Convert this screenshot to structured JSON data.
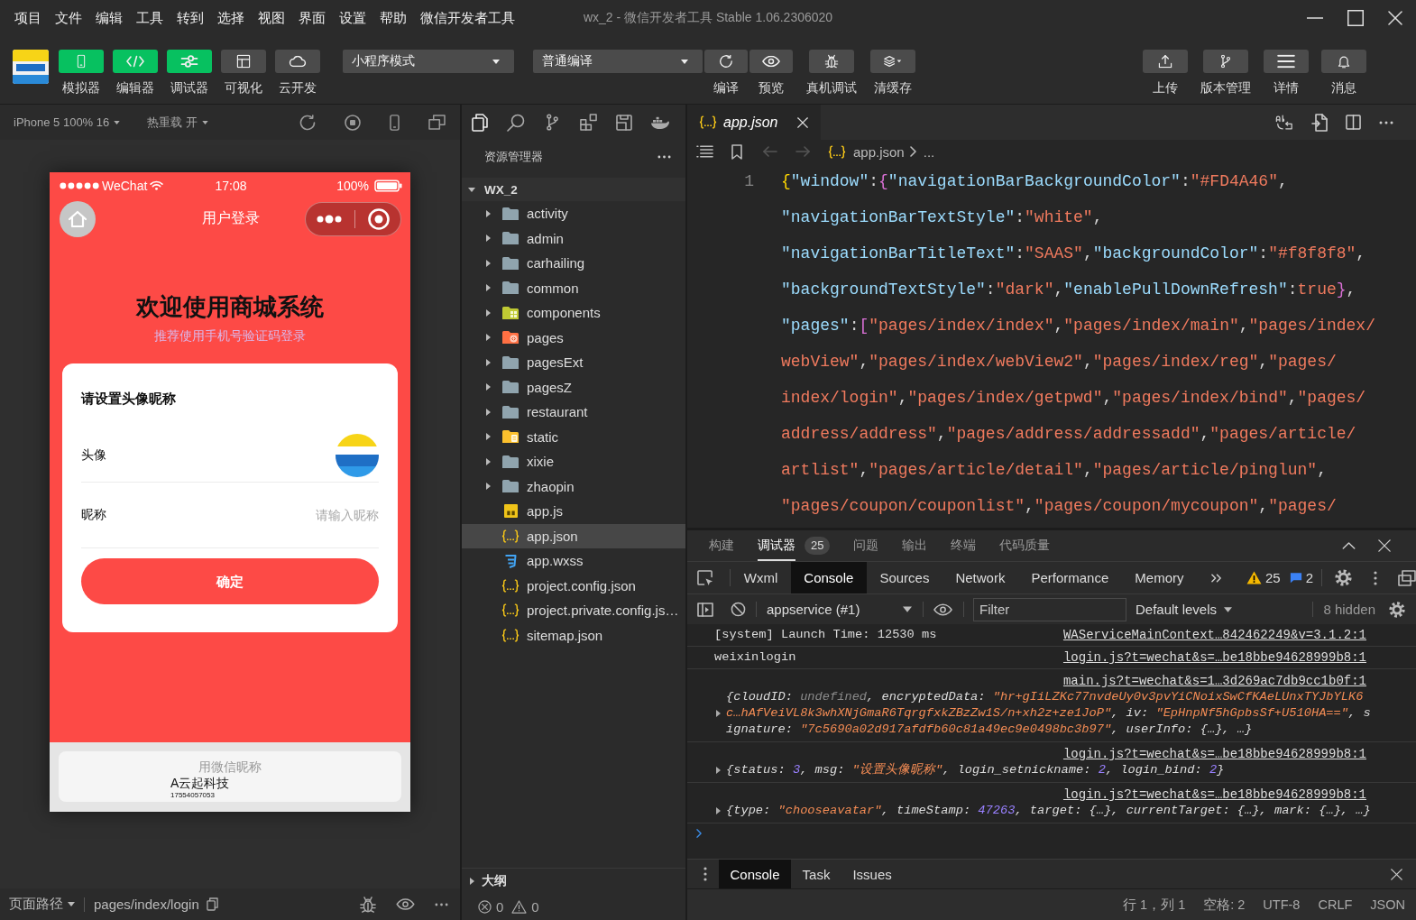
{
  "window": {
    "menu": [
      "项目",
      "文件",
      "编辑",
      "工具",
      "转到",
      "选择",
      "视图",
      "界面",
      "设置",
      "帮助",
      "微信开发者工具"
    ],
    "title": "wx_2 - 微信开发者工具 Stable 1.06.2306020"
  },
  "toolbar": {
    "panels": [
      {
        "kind": "simulator",
        "label": "模拟器",
        "on": true
      },
      {
        "kind": "editor",
        "label": "编辑器",
        "on": true
      },
      {
        "kind": "debugger",
        "label": "调试器",
        "on": true
      },
      {
        "kind": "visual",
        "label": "可视化",
        "on": false
      },
      {
        "kind": "cloud",
        "label": "云开发",
        "on": false
      }
    ],
    "mode": "小程序模式",
    "compile": "普通编译",
    "actions": [
      {
        "kind": "compile",
        "label": "编译"
      },
      {
        "kind": "preview",
        "label": "预览"
      },
      {
        "kind": "debug",
        "label": "真机调试"
      },
      {
        "kind": "cache",
        "label": "清缓存"
      }
    ],
    "tools": [
      {
        "kind": "upload",
        "label": "上传"
      },
      {
        "kind": "version",
        "label": "版本管理"
      },
      {
        "kind": "details",
        "label": "详情"
      },
      {
        "kind": "messages",
        "label": "消息"
      }
    ]
  },
  "simulator": {
    "device": "iPhone 5 100% 16",
    "hot_reload": "热重载 开",
    "phone": {
      "carrier": "WeChat",
      "time": "17:08",
      "battery": "100%",
      "title": "用户登录",
      "heading": "欢迎使用商城系统",
      "subheading": "推荐使用手机号验证码登录",
      "form": {
        "title": "请设置头像昵称",
        "avatar_label": "头像",
        "nickname_label": "昵称",
        "nickname_placeholder": "请输入昵称",
        "submit": "确定"
      },
      "nickname_sheet": {
        "title": "用微信昵称",
        "option": "A云起科技",
        "phone": "17554057053"
      }
    },
    "footer": {
      "path_label": "页面路径",
      "path": "pages/index/login"
    }
  },
  "explorer": {
    "title": "资源管理器",
    "tree": [
      {
        "label": "WX_2",
        "kind": "root",
        "expanded": true,
        "selected": false,
        "children": [
          {
            "label": "activity",
            "kind": "folder",
            "expanded": false,
            "selected": false
          },
          {
            "label": "admin",
            "kind": "folder",
            "expanded": false,
            "selected": false
          },
          {
            "label": "carhailing",
            "kind": "folder",
            "expanded": false,
            "selected": false
          },
          {
            "label": "common",
            "kind": "folder",
            "expanded": false,
            "selected": false
          },
          {
            "label": "components",
            "kind": "componentfolder",
            "expanded": false,
            "selected": false
          },
          {
            "label": "pages",
            "kind": "pagefolder",
            "expanded": false,
            "selected": false
          },
          {
            "label": "pagesExt",
            "kind": "folder",
            "expanded": false,
            "selected": false
          },
          {
            "label": "pagesZ",
            "kind": "folder",
            "expanded": false,
            "selected": false
          },
          {
            "label": "restaurant",
            "kind": "folder",
            "expanded": false,
            "selected": false
          },
          {
            "label": "static",
            "kind": "assetfolder",
            "expanded": false,
            "selected": false
          },
          {
            "label": "xixie",
            "kind": "folder",
            "expanded": false,
            "selected": false
          },
          {
            "label": "zhaopin",
            "kind": "folder",
            "expanded": false,
            "selected": false
          },
          {
            "label": "app.js",
            "kind": "js",
            "selected": false
          },
          {
            "label": "app.json",
            "kind": "json",
            "selected": true
          },
          {
            "label": "app.wxss",
            "kind": "wxss",
            "selected": false
          },
          {
            "label": "project.config.json",
            "kind": "json",
            "selected": false
          },
          {
            "label": "project.private.config.js…",
            "kind": "json",
            "selected": false
          },
          {
            "label": "sitemap.json",
            "kind": "json",
            "selected": false
          }
        ]
      }
    ],
    "outline": "大纲",
    "errors": "0",
    "warnings": "0"
  },
  "editor": {
    "tabs": [
      {
        "label": "app.json",
        "selected": true
      }
    ],
    "breadcrumb": {
      "file": "app.json",
      "trail": "..."
    },
    "line_numbers": [
      "1"
    ],
    "lines": [
      [
        {
          "kind": "brace",
          "text": "{"
        },
        {
          "kind": "key",
          "text": "\"window\""
        },
        {
          "kind": "punct",
          "text": ":"
        },
        {
          "kind": "bracket",
          "text": "{"
        },
        {
          "kind": "key",
          "text": "\"navigationBarBackgroundColor\""
        },
        {
          "kind": "punct",
          "text": ":"
        },
        {
          "kind": "string",
          "text": "\"#FD4A46\""
        },
        {
          "kind": "punct",
          "text": ","
        }
      ],
      [
        {
          "kind": "key",
          "text": "\"navigationBarTextStyle\""
        },
        {
          "kind": "punct",
          "text": ":"
        },
        {
          "kind": "string",
          "text": "\"white\""
        },
        {
          "kind": "punct",
          "text": ","
        }
      ],
      [
        {
          "kind": "key",
          "text": "\"navigationBarTitleText\""
        },
        {
          "kind": "punct",
          "text": ":"
        },
        {
          "kind": "string",
          "text": "\"SAAS\""
        },
        {
          "kind": "punct",
          "text": ","
        },
        {
          "kind": "key",
          "text": "\"backgroundColor\""
        },
        {
          "kind": "punct",
          "text": ":"
        },
        {
          "kind": "string",
          "text": "\"#f8f8f8\""
        },
        {
          "kind": "punct",
          "text": ","
        }
      ],
      [
        {
          "kind": "key",
          "text": "\"backgroundTextStyle\""
        },
        {
          "kind": "punct",
          "text": ":"
        },
        {
          "kind": "string",
          "text": "\"dark\""
        },
        {
          "kind": "punct",
          "text": ","
        },
        {
          "kind": "key",
          "text": "\"enablePullDownRefresh\""
        },
        {
          "kind": "punct",
          "text": ":"
        },
        {
          "kind": "literal",
          "text": "true"
        },
        {
          "kind": "bracket",
          "text": "}"
        },
        {
          "kind": "punct",
          "text": ","
        }
      ],
      [
        {
          "kind": "key",
          "text": "\"pages\""
        },
        {
          "kind": "punct",
          "text": ":"
        },
        {
          "kind": "bracket",
          "text": "["
        },
        {
          "kind": "string",
          "text": "\"pages/index/index\""
        },
        {
          "kind": "punct",
          "text": ","
        },
        {
          "kind": "string",
          "text": "\"pages/index/main\""
        },
        {
          "kind": "punct",
          "text": ","
        },
        {
          "kind": "string",
          "text": "\"pages/index/"
        }
      ],
      [
        {
          "kind": "string",
          "text": "webView\""
        },
        {
          "kind": "punct",
          "text": ","
        },
        {
          "kind": "string",
          "text": "\"pages/index/webView2\""
        },
        {
          "kind": "punct",
          "text": ","
        },
        {
          "kind": "string",
          "text": "\"pages/index/reg\""
        },
        {
          "kind": "punct",
          "text": ","
        },
        {
          "kind": "string",
          "text": "\"pages/"
        }
      ],
      [
        {
          "kind": "string",
          "text": "index/login\""
        },
        {
          "kind": "punct",
          "text": ","
        },
        {
          "kind": "string",
          "text": "\"pages/index/getpwd\""
        },
        {
          "kind": "punct",
          "text": ","
        },
        {
          "kind": "string",
          "text": "\"pages/index/bind\""
        },
        {
          "kind": "punct",
          "text": ","
        },
        {
          "kind": "string",
          "text": "\"pages/"
        }
      ],
      [
        {
          "kind": "string",
          "text": "address/address\""
        },
        {
          "kind": "punct",
          "text": ","
        },
        {
          "kind": "string",
          "text": "\"pages/address/addressadd\""
        },
        {
          "kind": "punct",
          "text": ","
        },
        {
          "kind": "string",
          "text": "\"pages/article/"
        }
      ],
      [
        {
          "kind": "string",
          "text": "artlist\""
        },
        {
          "kind": "punct",
          "text": ","
        },
        {
          "kind": "string",
          "text": "\"pages/article/detail\""
        },
        {
          "kind": "punct",
          "text": ","
        },
        {
          "kind": "string",
          "text": "\"pages/article/pinglun\""
        },
        {
          "kind": "punct",
          "text": ","
        }
      ],
      [
        {
          "kind": "string",
          "text": "\"pages/coupon/couponlist\""
        },
        {
          "kind": "punct",
          "text": ","
        },
        {
          "kind": "string",
          "text": "\"pages/coupon/mycoupon\""
        },
        {
          "kind": "punct",
          "text": ","
        },
        {
          "kind": "string",
          "text": "\"pages/"
        }
      ]
    ]
  },
  "devtools": {
    "panel_tabs": [
      {
        "label": "构建",
        "selected": false
      },
      {
        "label": "调试器",
        "selected": true,
        "badge": "25"
      },
      {
        "label": "问题",
        "selected": false
      },
      {
        "label": "输出",
        "selected": false
      },
      {
        "label": "终端",
        "selected": false
      },
      {
        "label": "代码质量",
        "selected": false
      }
    ],
    "tabs": [
      {
        "label": "Wxml",
        "selected": false
      },
      {
        "label": "Console",
        "selected": true
      },
      {
        "label": "Sources",
        "selected": false
      },
      {
        "label": "Network",
        "selected": false
      },
      {
        "label": "Performance",
        "selected": false
      },
      {
        "label": "Memory",
        "selected": false
      }
    ],
    "warning_count": "25",
    "message_count": "2",
    "context": "appservice (#1)",
    "filter_placeholder": "Filter",
    "levels": "Default levels",
    "hidden": "8 hidden",
    "logs": [
      {
        "kind": "text",
        "source": "WAServiceMainContext…842462249&v=3.1.2:1",
        "lines": [
          [
            {
              "kind": "plain",
              "text": "[system] Launch Time: 12530 ms"
            }
          ]
        ]
      },
      {
        "kind": "text",
        "source": "login.js?t=wechat&s=…be18bbe94628999b8:1",
        "lines": [
          [
            {
              "kind": "plain",
              "text": "weixinlogin"
            }
          ]
        ]
      },
      {
        "kind": "object",
        "source": "main.js?t=wechat&s=1…3d269ac7db9cc1b0f:1",
        "lines": [
          [
            {
              "kind": "punct",
              "text": "{"
            },
            {
              "kind": "key",
              "text": "cloudID"
            },
            {
              "kind": "punct",
              "text": ": "
            },
            {
              "kind": "undefined",
              "text": "undefined"
            },
            {
              "kind": "punct",
              "text": ", "
            },
            {
              "kind": "key",
              "text": "encryptedData"
            },
            {
              "kind": "punct",
              "text": ": "
            },
            {
              "kind": "string",
              "text": "\"hr+gIiLZKc77nvdeUy0v3pvYiCNoixSwCfKAeLUnxTYJbYLK6"
            }
          ],
          [
            {
              "kind": "string",
              "text": "c…hAfVeiVL8k3whXNjGmaR6TqrgfxkZBzZw1S/n+xh2z+ze1JoP\""
            },
            {
              "kind": "punct",
              "text": ", "
            },
            {
              "kind": "key",
              "text": "iv"
            },
            {
              "kind": "punct",
              "text": ": "
            },
            {
              "kind": "string",
              "text": "\"EpHnpNf5hGpbsSf+U510HA==\""
            },
            {
              "kind": "punct",
              "text": ", "
            },
            {
              "kind": "key",
              "text": "s"
            }
          ],
          [
            {
              "kind": "key",
              "text": "ignature"
            },
            {
              "kind": "punct",
              "text": ": "
            },
            {
              "kind": "string",
              "text": "\"7c5690a02d917afdfb60c81a49ec9e0498bc3b97\""
            },
            {
              "kind": "punct",
              "text": ", "
            },
            {
              "kind": "key",
              "text": "userInfo"
            },
            {
              "kind": "punct",
              "text": ": {…}, …}"
            }
          ]
        ]
      },
      {
        "kind": "object",
        "source": "login.js?t=wechat&s=…be18bbe94628999b8:1",
        "lines": [
          [
            {
              "kind": "punct",
              "text": "{"
            },
            {
              "kind": "key",
              "text": "status"
            },
            {
              "kind": "punct",
              "text": ": "
            },
            {
              "kind": "number",
              "text": "3"
            },
            {
              "kind": "punct",
              "text": ", "
            },
            {
              "kind": "key",
              "text": "msg"
            },
            {
              "kind": "punct",
              "text": ": "
            },
            {
              "kind": "string",
              "text": "\"设置头像昵称\""
            },
            {
              "kind": "punct",
              "text": ", "
            },
            {
              "kind": "key",
              "text": "login_setnickname"
            },
            {
              "kind": "punct",
              "text": ": "
            },
            {
              "kind": "number",
              "text": "2"
            },
            {
              "kind": "punct",
              "text": ", "
            },
            {
              "kind": "key",
              "text": "login_bind"
            },
            {
              "kind": "punct",
              "text": ": "
            },
            {
              "kind": "number",
              "text": "2"
            },
            {
              "kind": "punct",
              "text": "}"
            }
          ]
        ]
      },
      {
        "kind": "object",
        "source": "login.js?t=wechat&s=…be18bbe94628999b8:1",
        "lines": [
          [
            {
              "kind": "punct",
              "text": "{"
            },
            {
              "kind": "key",
              "text": "type"
            },
            {
              "kind": "punct",
              "text": ": "
            },
            {
              "kind": "string",
              "text": "\"chooseavatar\""
            },
            {
              "kind": "punct",
              "text": ", "
            },
            {
              "kind": "key",
              "text": "timeStamp"
            },
            {
              "kind": "punct",
              "text": ": "
            },
            {
              "kind": "number",
              "text": "47263"
            },
            {
              "kind": "punct",
              "text": ", "
            },
            {
              "kind": "key",
              "text": "target"
            },
            {
              "kind": "punct",
              "text": ": {…}, "
            },
            {
              "kind": "key",
              "text": "currentTarget"
            },
            {
              "kind": "punct",
              "text": ": {…}, "
            },
            {
              "kind": "key",
              "text": "mark"
            },
            {
              "kind": "punct",
              "text": ": {…}, …}"
            }
          ]
        ]
      }
    ],
    "drawer_tabs": [
      {
        "label": "Console",
        "selected": true
      },
      {
        "label": "Task",
        "selected": false
      },
      {
        "label": "Issues",
        "selected": false
      }
    ]
  },
  "status_bar": {
    "position": "行 1，列 1",
    "indent": "空格: 2",
    "encoding": "UTF-8",
    "line_ending": "CRLF",
    "language": "JSON"
  }
}
